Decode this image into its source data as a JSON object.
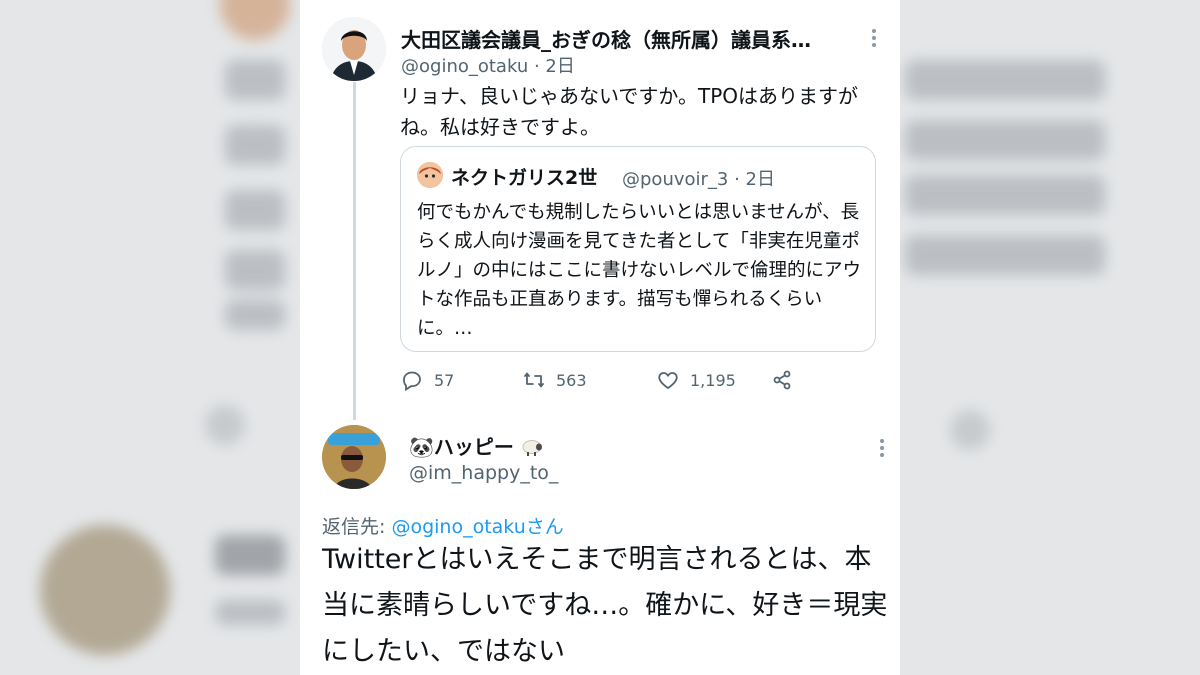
{
  "tweet1": {
    "display_name": "大田区議会議員_おぎの稔（無所属）議員系…",
    "handle": "@ogino_otaku",
    "time": "· 2日",
    "text": "リョナ、良いじゃあないですか。TPOはありますがね。私は好きですよ。",
    "quote": {
      "display_name": "ネクトガリス2世",
      "handle": "@pouvoir_3",
      "time": "· 2日",
      "text": "何でもかんでも規制したらいいとは思いませんが、長らく成人向け漫画を見てきた者として「非実在児童ポルノ」の中にはここに書けないレベルで倫理的にアウトな作品も正直あります。描写も憚られるくらいに。…"
    },
    "actions": {
      "replies": "57",
      "retweets": "563",
      "likes": "1,195"
    }
  },
  "tweet2": {
    "display_name": "🐼ハッピー",
    "handle": "@im_happy_to_",
    "reply_prefix": "返信先: ",
    "reply_to": "@ogino_otaku",
    "reply_suffix": "さん",
    "text": "Twitterとはいえそこまで明言されるとは、本当に素晴らしいですね…。確かに、好き＝現実にしたい、ではない"
  },
  "colors": {
    "link_blue": "#1d9bf0",
    "secondary_text": "#536471",
    "border": "#cfd9de"
  },
  "icons": [
    "more-vertical-icon",
    "reply-icon",
    "retweet-icon",
    "like-icon",
    "share-icon",
    "sheep-emoji-icon"
  ]
}
